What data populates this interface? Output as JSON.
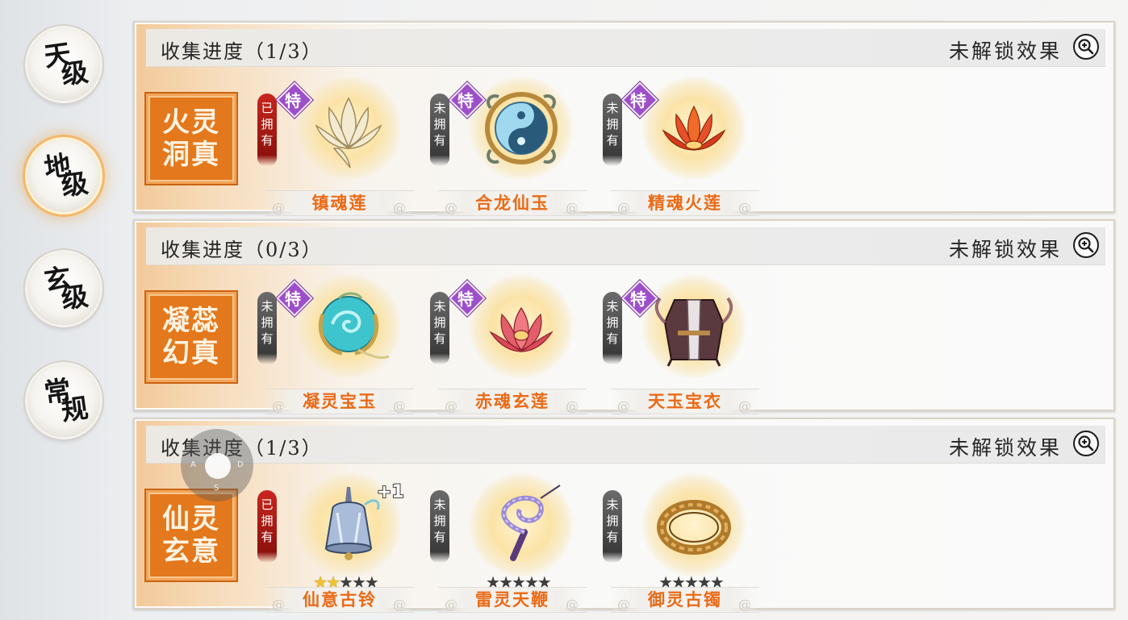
{
  "tiers": [
    {
      "chars": [
        "天",
        "级"
      ],
      "active": false
    },
    {
      "chars": [
        "地",
        "级"
      ],
      "active": true
    },
    {
      "chars": [
        "玄",
        "级"
      ],
      "active": false
    },
    {
      "chars": [
        "常",
        "规"
      ],
      "active": false
    }
  ],
  "panels": [
    {
      "progress": "收集进度（1/3）",
      "effect_label": "未解锁效果",
      "set_name": "火灵洞真",
      "items": [
        {
          "name": "镇魂莲",
          "owned": true,
          "owned_label": "已拥有",
          "special": "特",
          "icon": "white-lotus-icon"
        },
        {
          "name": "合龙仙玉",
          "owned": false,
          "owned_label": "未拥有",
          "special": "特",
          "icon": "yin-yang-jade-icon"
        },
        {
          "name": "精魂火莲",
          "owned": false,
          "owned_label": "未拥有",
          "special": "特",
          "icon": "fire-lotus-icon"
        }
      ]
    },
    {
      "progress": "收集进度（0/3）",
      "effect_label": "未解锁效果",
      "set_name": "凝蕊幻真",
      "items": [
        {
          "name": "凝灵宝玉",
          "owned": false,
          "owned_label": "未拥有",
          "special": "特",
          "icon": "cyan-orb-jade-icon"
        },
        {
          "name": "赤魂玄莲",
          "owned": false,
          "owned_label": "未拥有",
          "special": "特",
          "icon": "red-lotus-icon"
        },
        {
          "name": "天玉宝衣",
          "owned": false,
          "owned_label": "未拥有",
          "special": "特",
          "icon": "armor-robe-icon"
        }
      ]
    },
    {
      "progress": "收集进度（1/3）",
      "effect_label": "未解锁效果",
      "set_name": "仙灵玄意",
      "items": [
        {
          "name": "仙意古铃",
          "owned": true,
          "owned_label": "已拥有",
          "plus": "+1",
          "stars": 2,
          "max_stars": 5,
          "icon": "ancient-bell-icon"
        },
        {
          "name": "雷灵天鞭",
          "owned": false,
          "owned_label": "未拥有",
          "stars": 0,
          "max_stars": 5,
          "icon": "thunder-whip-icon"
        },
        {
          "name": "御灵古镯",
          "owned": false,
          "owned_label": "未拥有",
          "stars": 0,
          "max_stars": 5,
          "icon": "bronze-bracelet-icon"
        }
      ]
    }
  ],
  "joystick": {
    "keys": [
      "A",
      "D",
      "S"
    ]
  }
}
